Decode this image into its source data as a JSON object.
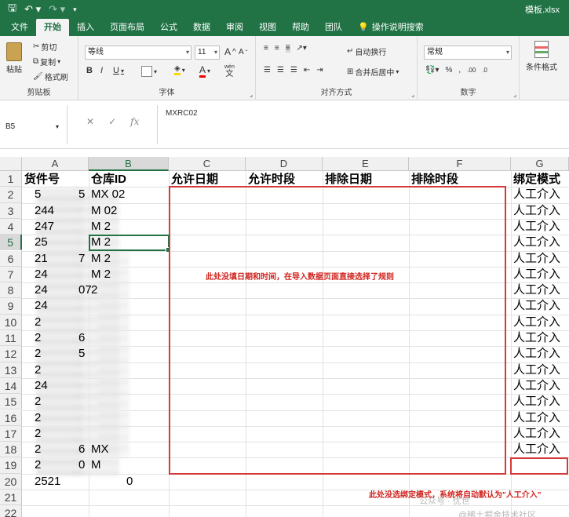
{
  "titlebar": {
    "filename": "模板.xlsx"
  },
  "tabs": [
    {
      "label": "文件"
    },
    {
      "label": "开始"
    },
    {
      "label": "插入"
    },
    {
      "label": "页面布局"
    },
    {
      "label": "公式"
    },
    {
      "label": "数据"
    },
    {
      "label": "审阅"
    },
    {
      "label": "视图"
    },
    {
      "label": "帮助"
    },
    {
      "label": "团队"
    },
    {
      "label": "操作说明搜索"
    }
  ],
  "ribbon": {
    "clipboard": {
      "label": "剪贴板",
      "paste": "粘贴",
      "cut": "剪切",
      "copy": "复制",
      "format_painter": "格式刷"
    },
    "font": {
      "label": "字体",
      "font_name": "等线",
      "font_size": "11",
      "bold": "B",
      "italic": "I",
      "underline": "U",
      "grow": "A",
      "shrink": "A",
      "font_color": "A",
      "wen": "wén"
    },
    "alignment": {
      "label": "对齐方式",
      "wrap": "自动换行",
      "merge": "合并后居中"
    },
    "number": {
      "label": "数字",
      "format": "常规"
    },
    "styles": {
      "label": "条件格式"
    }
  },
  "formula_bar": {
    "name_box": "B5",
    "fx": "fx",
    "content": "MXRC02"
  },
  "columns": [
    {
      "letter": "A"
    },
    {
      "letter": "B"
    },
    {
      "letter": "C"
    },
    {
      "letter": "D"
    },
    {
      "letter": "E"
    },
    {
      "letter": "F"
    },
    {
      "letter": "G"
    }
  ],
  "rows": [
    "1",
    "2",
    "3",
    "4",
    "5",
    "6",
    "7",
    "8",
    "9",
    "10",
    "11",
    "12",
    "13",
    "14",
    "15",
    "16",
    "17",
    "18",
    "19",
    "20",
    "21",
    "22"
  ],
  "headers": {
    "a": "货件号",
    "b": "仓库ID",
    "c": "允许日期",
    "d": "允许时段",
    "e": "排除日期",
    "f": "排除时段",
    "g": "绑定模式"
  },
  "col_a_visible": [
    "5",
    "244",
    "247",
    "25",
    "21",
    "24",
    "24",
    "24",
    "2",
    "2",
    "2",
    "2",
    "24",
    "2",
    "2",
    "2",
    "2",
    "2",
    "2521"
  ],
  "col_a_tail": [
    "5",
    "",
    "",
    "",
    "7",
    "",
    "07",
    "",
    "",
    "6",
    "5",
    "",
    "",
    "",
    "",
    "",
    "6",
    "0",
    ""
  ],
  "col_b_visible": [
    "MX 02",
    "M 02",
    "M 2",
    "M 2",
    "M 2",
    "M 2",
    "2",
    "",
    "",
    "",
    "",
    "",
    "",
    "",
    "",
    "",
    "MX",
    "M",
    ""
  ],
  "col_b_tail": [
    "",
    "",
    "",
    "",
    "",
    "",
    "",
    "",
    "",
    "",
    "",
    "",
    "",
    "",
    "",
    "",
    "",
    "",
    "0"
  ],
  "col_g_values": [
    "人工介入",
    "人工介入",
    "人工介入",
    "人工介入",
    "人工介入",
    "人工介入",
    "人工介入",
    "人工介入",
    "人工介入",
    "人工介入",
    "人工介入",
    "人工介入",
    "人工介入",
    "人工介入",
    "人工介入",
    "人工介入",
    "人工介入"
  ],
  "annotations": {
    "note1": "此处没填日期和时间，在导入数据页面直接选择了规则",
    "note2": "此处没选绑定模式，系统将自动默认为\"人工介入\""
  },
  "watermark": {
    "line1": "公众号 · 优世",
    "line2": "@稀土掘金技术社区"
  },
  "colors": {
    "excel_green": "#217346",
    "annotation_red": "#d43a3a"
  }
}
